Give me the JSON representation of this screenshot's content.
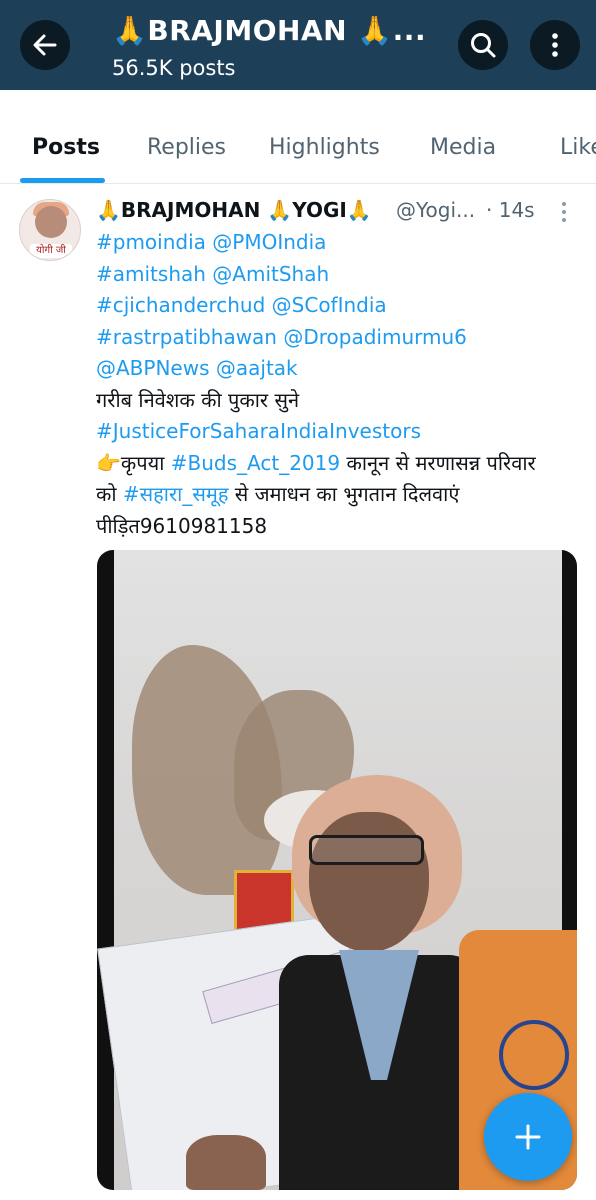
{
  "header": {
    "title": "🙏BRAJMOHAN 🙏...",
    "subtitle": "56.5K posts",
    "back_icon": "arrow-left-icon",
    "search_icon": "search-icon",
    "more_icon": "more-vertical-icon",
    "background_color": "#1d3f58"
  },
  "tabs": [
    {
      "label": "Posts",
      "active": true
    },
    {
      "label": "Replies",
      "active": false
    },
    {
      "label": "Highlights",
      "active": false
    },
    {
      "label": "Media",
      "active": false
    },
    {
      "label": "Likes",
      "active": false
    }
  ],
  "post": {
    "avatar_label": "योगी जी",
    "author": "🙏BRAJMOHAN 🙏YOGI🙏",
    "handle": "@Yogi...",
    "time": "· 14s",
    "lines": [
      {
        "parts": [
          {
            "text": "#pmoindia",
            "link": true
          },
          {
            "text": " ",
            "link": false
          },
          {
            "text": "@PMOIndia",
            "link": true
          }
        ]
      },
      {
        "parts": [
          {
            "text": "#amitshah",
            "link": true
          },
          {
            "text": " ",
            "link": false
          },
          {
            "text": "@AmitShah",
            "link": true
          }
        ]
      },
      {
        "parts": [
          {
            "text": "#cjichanderchud",
            "link": true
          },
          {
            "text": " ",
            "link": false
          },
          {
            "text": "@SCofIndia",
            "link": true
          }
        ]
      },
      {
        "parts": [
          {
            "text": "#rastrpatibhawan",
            "link": true
          },
          {
            "text": " ",
            "link": false
          },
          {
            "text": "@Dropadimurmu6",
            "link": true
          }
        ]
      },
      {
        "parts": [
          {
            "text": "@ABPNews",
            "link": true
          },
          {
            "text": " ",
            "link": false
          },
          {
            "text": "@aajtak",
            "link": true
          }
        ]
      },
      {
        "parts": [
          {
            "text": "गरीब निवेशक की पुकार सुने",
            "link": false
          }
        ]
      },
      {
        "parts": [
          {
            "text": "#JusticeForSaharaIndiaInvestors",
            "link": true
          }
        ]
      },
      {
        "parts": [
          {
            "text": "👉कृपया ",
            "link": false
          },
          {
            "text": "#Buds_Act_2019",
            "link": true
          },
          {
            "text": " कानून से मरणासन्न परिवार",
            "link": false
          }
        ]
      },
      {
        "parts": [
          {
            "text": "को ",
            "link": false
          },
          {
            "text": "#सहारा_समूह",
            "link": true
          },
          {
            "text": " से जमाधन का भुगतान दिलवाएं",
            "link": false
          }
        ]
      },
      {
        "parts": [
          {
            "text": "पीड़ित9610981158",
            "link": false
          }
        ]
      }
    ],
    "link_color": "#1d9bf0"
  },
  "fab": {
    "icon": "plus-icon",
    "color": "#1d9bf0"
  }
}
